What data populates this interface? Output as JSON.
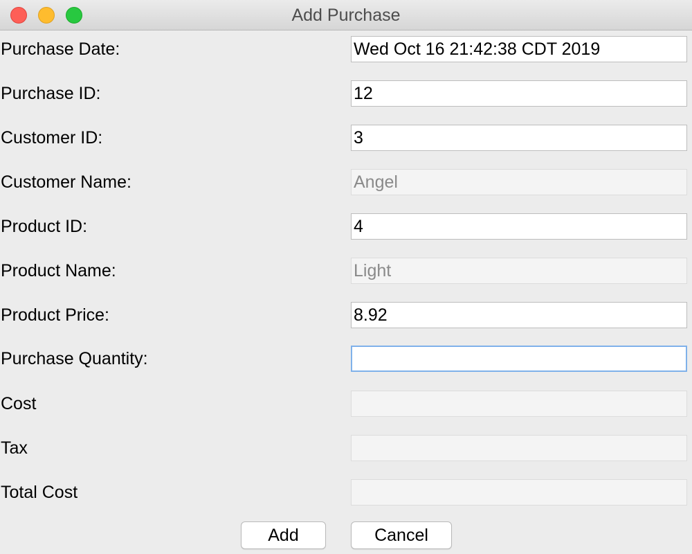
{
  "window": {
    "title": "Add Purchase"
  },
  "form": {
    "fields": [
      {
        "label": "Purchase Date:",
        "value": "Wed Oct 16 21:42:38 CDT 2019",
        "state": "normal"
      },
      {
        "label": "Purchase ID:",
        "value": "12",
        "state": "normal"
      },
      {
        "label": "Customer ID:",
        "value": "3",
        "state": "normal"
      },
      {
        "label": "Customer Name:",
        "value": "Angel",
        "state": "disabled"
      },
      {
        "label": "Product ID:",
        "value": "4",
        "state": "normal"
      },
      {
        "label": "Product Name:",
        "value": "Light",
        "state": "disabled"
      },
      {
        "label": "Product Price:",
        "value": "8.92",
        "state": "normal"
      },
      {
        "label": "Purchase Quantity:",
        "value": "",
        "state": "focused"
      },
      {
        "label": "Cost",
        "value": "",
        "state": "disabled"
      },
      {
        "label": "Tax",
        "value": "",
        "state": "disabled"
      },
      {
        "label": "Total Cost",
        "value": "",
        "state": "disabled"
      }
    ]
  },
  "buttons": {
    "add_label": "Add",
    "cancel_label": "Cancel"
  },
  "colors": {
    "window_background": "#ececec",
    "focus_ring": "#7fb1ea",
    "close": "#fe5f57",
    "minimize": "#febc2e",
    "zoom": "#28c840",
    "disabled_text": "#8a8a8a"
  },
  "icons": {
    "close": "close-icon",
    "minimize": "minimize-icon",
    "zoom": "zoom-icon"
  }
}
